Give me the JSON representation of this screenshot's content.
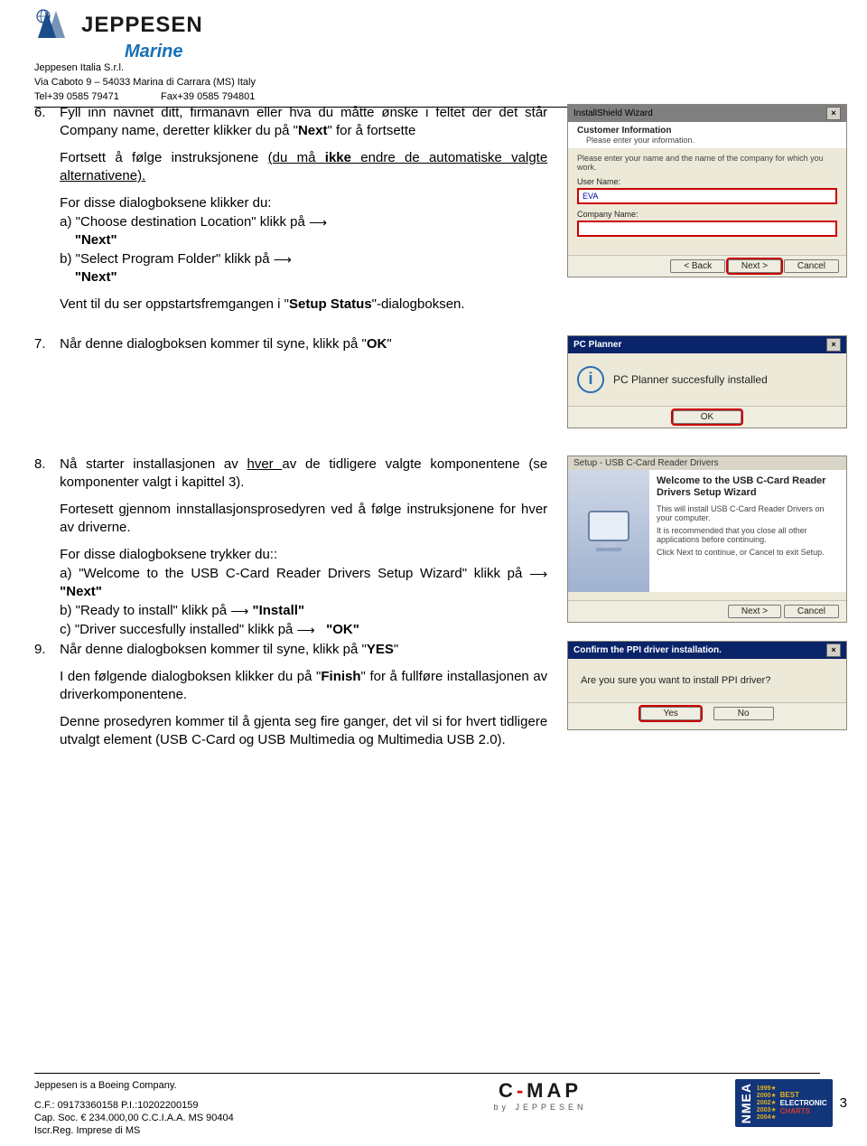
{
  "header": {
    "brand": "JEPPESEN",
    "brand_sub": "Marine",
    "legal1": "Jeppesen Italia S.r.l.",
    "legal2": "Via Caboto 9 – 54033 Marina di Carrara (MS) Italy",
    "tel": "Tel+39 0585 79471",
    "fax": "Fax+39 0585 794801"
  },
  "step6": {
    "num": "6.",
    "p1a": "Fyll inn navnet ditt, firmanavn eller hva du måtte ønske i feltet der det står Company name, deretter klikker du på \"",
    "p1b": "Next",
    "p1c": "\" for å fortsette",
    "p2a": "Fortsett å følge instruksjonene ",
    "p2u": "(du må ",
    "p2b": "ikke",
    "p2u2": " endre de automatiske valgte alternativene).",
    "p3": "For disse dialogboksene klikker du:",
    "p3a1": "a) \"Choose destination Location\" klikk på",
    "p3a2": "\"Next\"",
    "p3b1": "b) \"Select Program Folder\" klikk på",
    "p3b2": "\"Next\"",
    "p4a": "Vent til du ser oppstartsfremgangen i \"",
    "p4b": "Setup Status",
    "p4c": "\"-dialogboksen."
  },
  "step7": {
    "num": "7.",
    "p1a": "Når denne dialogboksen kommer til syne, klikk på \"",
    "p1b": "OK",
    "p1c": "\""
  },
  "step8": {
    "num": "8.",
    "p1a": "Nå starter installasjonen av ",
    "p1u": "hver ",
    "p1b": "av de tidligere valgte komponentene (se komponenter valgt i kapittel 3).",
    "p2": "Fortesett gjennom innstallasjonsprosedyren ved å følge instruksjonene for hver av driverne.",
    "p3": "For disse dialogboksene trykker du::",
    "p3a": "a) \"Welcome to the USB C-Card Reader Drivers Setup Wizard\" klikk på ",
    "p3a2": "\"Next\"",
    "p3b": "b) \"Ready to install\" klikk på ",
    "p3b2": "\"Install\"",
    "p3c": "c) \"Driver succesfully installed\" klikk på ",
    "p3c2": "\"OK\""
  },
  "step9": {
    "num": "9.",
    "p1a": "Når denne dialogboksen kommer til syne, klikk på \"",
    "p1b": "YES",
    "p1c": "\"",
    "p2a": "I den følgende dialogboksen klikker du på \"",
    "p2b": "Finish",
    "p2c": "\" for å fullføre installasjonen av driverkomponentene.",
    "p3": "Denne prosedyren kommer til å gjenta seg fire ganger, det vil si for hvert tidligere utvalgt element (USB C-Card og USB Multimedia og Multimedia USB 2.0)."
  },
  "shot1": {
    "title": "InstallShield Wizard",
    "heading": "Customer Information",
    "sub": "Please enter your information.",
    "desc": "Please enter your name and the name of the company for which you work.",
    "lbl_user": "User Name:",
    "user_value": "EVA",
    "lbl_company": "Company Name:",
    "back": "< Back",
    "next": "Next >",
    "cancel": "Cancel"
  },
  "shot2": {
    "title": "PC Planner",
    "msg": "PC Planner succesfully installed",
    "ok": "OK"
  },
  "shot3": {
    "title": "Setup - USB C-Card Reader Drivers",
    "heading": "Welcome to the USB C-Card Reader Drivers Setup Wizard",
    "l1": "This will install USB C-Card Reader Drivers on your computer.",
    "l2": "It is recommended that you close all other applications before continuing.",
    "l3": "Click Next to continue, or Cancel to exit Setup.",
    "next": "Next >",
    "cancel": "Cancel"
  },
  "shot4": {
    "title": "Confirm the PPI driver installation.",
    "msg": "Are you sure you want to install PPI driver?",
    "yes": "Yes",
    "no": "No"
  },
  "footer": {
    "boeing": "Jeppesen is a Boeing Company.",
    "cf": "C.F.: 09173360158  P.I.:10202200159",
    "cap": "Cap. Soc. € 234.000,00  C.C.I.A.A. MS 90404",
    "iscr": "Iscr.Reg. Imprese di MS",
    "page": "3",
    "cmap": "C-MAP",
    "cmap_sub": "by JEPPESEN",
    "nmea_title": "NMEA",
    "nmea_years": "1999 2000 2002 2003 2004",
    "nmea_label": "BEST ELECTRONIC CHARTS"
  }
}
